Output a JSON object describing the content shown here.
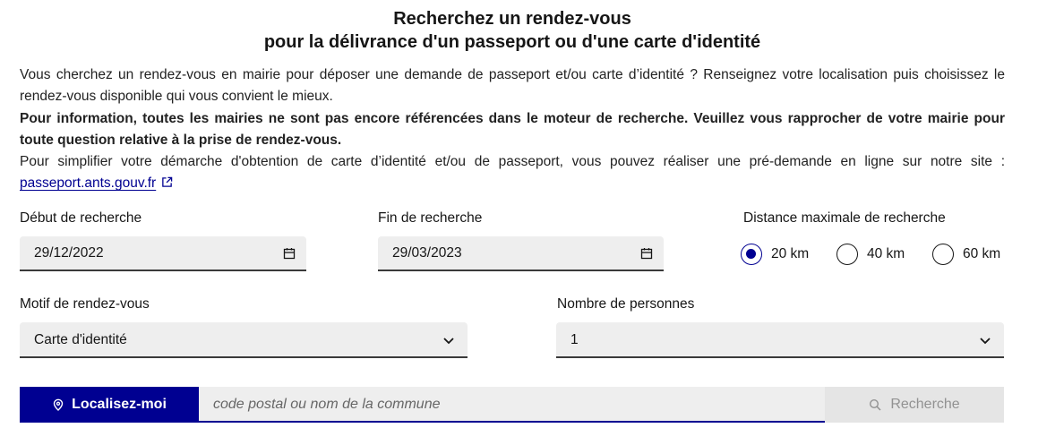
{
  "title": {
    "line1": "Recherchez un rendez-vous",
    "line2": "pour la délivrance d'un passeport ou d'une carte d'identité"
  },
  "intro": {
    "p1": "Vous cherchez un rendez-vous en mairie pour déposer une demande de passeport et/ou carte d’identité ? Renseignez votre localisation puis choisissez le rendez-vous disponible qui vous convient le mieux.",
    "p2": "Pour information, toutes les mairies ne sont pas encore référencées dans le moteur de recherche. Veuillez vous rapprocher de votre mairie pour toute question relative à la prise de rendez-vous.",
    "p3": "Pour simplifier votre démarche d'obtention de carte d’identité et/ou de passeport, vous pouvez réaliser une pré-demande en ligne sur notre site :",
    "link": "passeport.ants.gouv.fr",
    "link_icon": "external-link-icon"
  },
  "start_date": {
    "label": "Début de recherche",
    "value": "29/12/2022",
    "icon": "calendar-icon"
  },
  "end_date": {
    "label": "Fin de recherche",
    "value": "29/03/2023",
    "icon": "calendar-icon"
  },
  "distance": {
    "label": "Distance maximale de recherche",
    "options": [
      "20 km",
      "40 km",
      "60 km"
    ],
    "selected": "20 km"
  },
  "motif": {
    "label": "Motif de rendez-vous",
    "value": "Carte d'identité",
    "icon": "chevron-down-icon"
  },
  "persons": {
    "label": "Nombre de personnes",
    "value": "1",
    "icon": "chevron-down-icon"
  },
  "search": {
    "locate_label": "Localisez-moi",
    "locate_icon": "map-pin-icon",
    "placeholder": "code postal ou nom de la commune",
    "search_label": "Recherche",
    "search_icon": "search-icon"
  },
  "colors": {
    "primary": "#000091",
    "field_bg": "#eeeeee",
    "disabled_text": "#929292"
  }
}
